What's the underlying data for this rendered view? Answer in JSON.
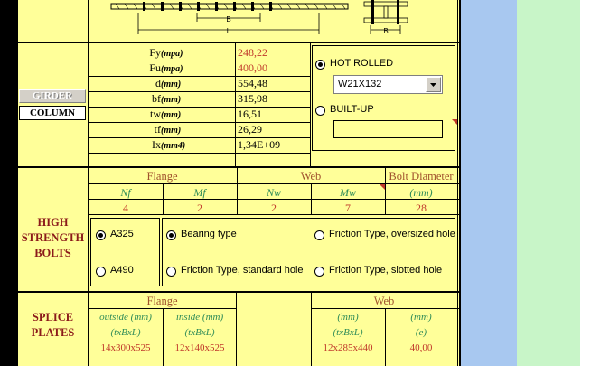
{
  "sidebar": {
    "girder_label": "GIRDER",
    "column_label": "COLUMN"
  },
  "properties": [
    {
      "name": "Fy",
      "unit": "(mpa)",
      "value": "248,22",
      "red": true
    },
    {
      "name": "Fu",
      "unit": "(mpa)",
      "value": "400,00",
      "red": true
    },
    {
      "name": "d",
      "unit": "(mm)",
      "value": "554,48",
      "red": false
    },
    {
      "name": "bf",
      "unit": "(mm)",
      "value": "315,98",
      "red": false
    },
    {
      "name": "tw",
      "unit": "(mm)",
      "value": "16,51",
      "red": false
    },
    {
      "name": "tf",
      "unit": "(mm)",
      "value": "26,29",
      "red": false
    },
    {
      "name": "Ix",
      "unit": "(mm4)",
      "value": "1,34E+09",
      "red": false
    }
  ],
  "section_type": {
    "hot_rolled_label": "HOT ROLLED",
    "hot_rolled_selected": true,
    "profile_value": "W21X132",
    "built_up_label": "BUILT-UP",
    "built_up_selected": false,
    "built_up_value": ""
  },
  "bolts": {
    "section_label": "HIGH\nSTRENGTH\nBOLTS",
    "headers": {
      "flange": "Flange",
      "web": "Web",
      "bolt_diameter": "Bolt Diameter"
    },
    "subheaders": {
      "nf": "Nf",
      "mf": "Mf",
      "nw": "Nw",
      "mw": "Mw",
      "diameter_unit": "(mm)"
    },
    "values": {
      "nf": "4",
      "mf": "2",
      "nw": "2",
      "mw": "7",
      "diameter": "28"
    },
    "grade_options": [
      {
        "label": "A325",
        "selected": true
      },
      {
        "label": "A490",
        "selected": false
      }
    ],
    "type_options": [
      {
        "label": "Bearing type",
        "selected": true
      },
      {
        "label": "Friction Type, oversized hole",
        "selected": false
      },
      {
        "label": "Friction Type, standard hole",
        "selected": false
      },
      {
        "label": "Friction Type, slotted hole",
        "selected": false
      }
    ]
  },
  "splice": {
    "section_label": "SPLICE\nPLATES",
    "flange_header": "Flange",
    "web_header": "Web",
    "outside_label": "outside (mm)",
    "inside_label": "inside (mm)",
    "web_mm_label": "(mm)",
    "web_mm_label2": "(mm)",
    "txbxl": "(txBxL)",
    "e_label": "(e)",
    "outside_value": "14x300x525",
    "inside_value": "12x140x525",
    "web_value": "12x285x440",
    "e_value": "40,00"
  },
  "drawing": {
    "dim_b": "B",
    "dim_l": "L",
    "dim_b2": "B"
  },
  "colors": {
    "sheet": "#ffff99",
    "blue_panel": "#a8c8f0",
    "green_panel": "#c8f5c8",
    "value_red": "#c0392b",
    "header_brown": "#a0522d",
    "section_red": "#8b1a1a",
    "sub_green": "#2e8b57"
  }
}
